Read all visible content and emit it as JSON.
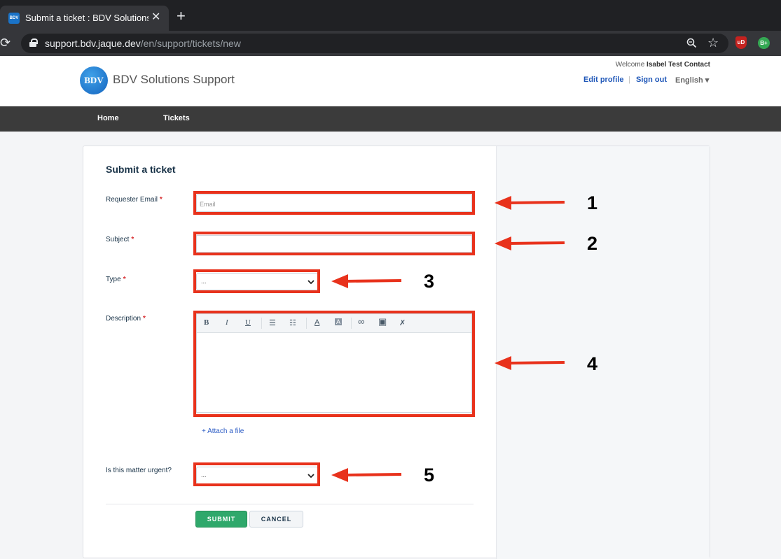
{
  "browser": {
    "tab_title": "Submit a ticket : BDV Solutions Support",
    "favicon_text": "BDV",
    "tab_close": "✕",
    "new_tab": "+",
    "url_host": "support.bdv.jaque.dev",
    "url_path": "/en/support/tickets/new",
    "ext1": "uD",
    "ext2": "B+"
  },
  "header": {
    "logo_text": "BDV",
    "brand": "BDV Solutions Support",
    "welcome_prefix": "Welcome ",
    "user_name": "Isabel Test Contact",
    "edit_profile": "Edit profile",
    "separator": "|",
    "sign_out": "Sign out",
    "language": "English ▾"
  },
  "nav": {
    "items": [
      {
        "label": "Home"
      },
      {
        "label": "Tickets"
      }
    ]
  },
  "form": {
    "title": "Submit a ticket",
    "required_mark": "*",
    "requester_label": "Requester Email",
    "requester_placeholder": "Email",
    "subject_label": "Subject",
    "type_label": "Type",
    "type_value": "...",
    "description_label": "Description",
    "attach_label": "+ Attach a file",
    "urgent_label": "Is this matter urgent?",
    "urgent_value": "...",
    "submit": "SUBMIT",
    "cancel": "CANCEL"
  },
  "toolbar": {
    "bold": "B",
    "italic": "I",
    "underline": "U",
    "bullet_list": "☰",
    "numbered_list": "☷",
    "font_color": "A",
    "bg_color": "A",
    "link": "∞",
    "image": "▣",
    "clear": "✗"
  },
  "annotations": {
    "color": "#e8321c",
    "numbers": [
      "1",
      "2",
      "3",
      "4",
      "5"
    ]
  }
}
